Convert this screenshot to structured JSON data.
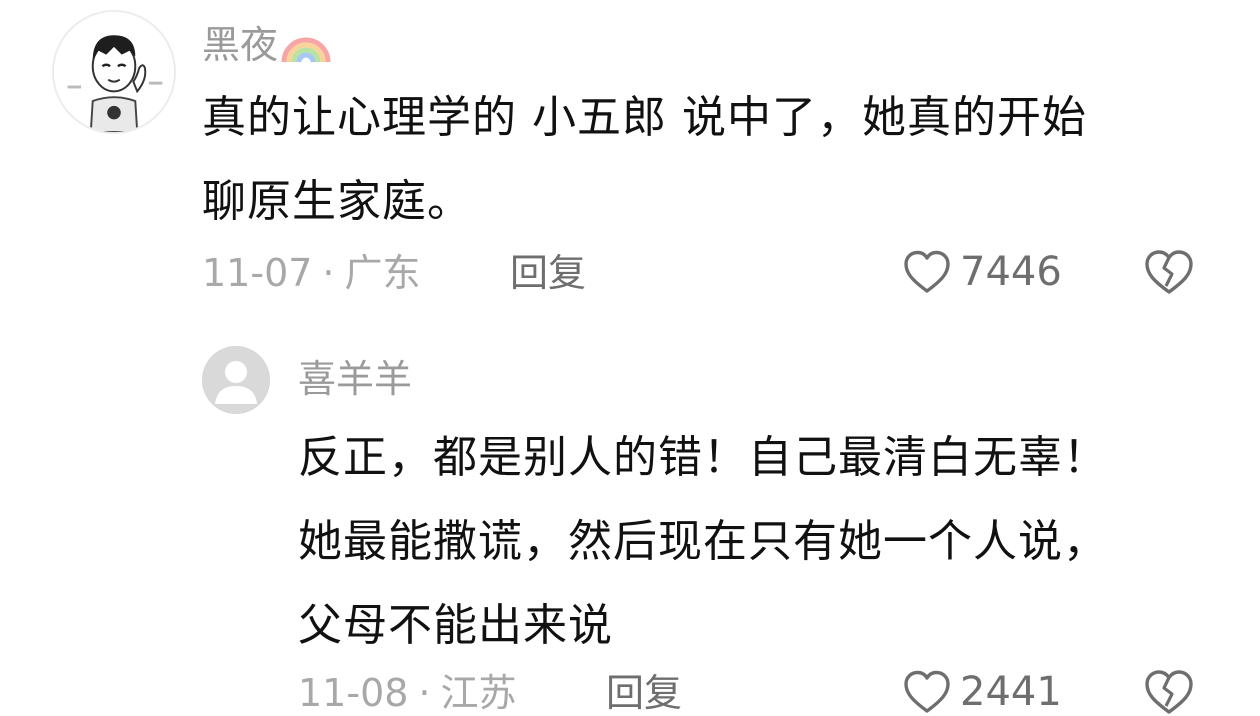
{
  "comment": {
    "username": "黑夜",
    "username_icon": "rainbow-icon",
    "text_lines": [
      "真的让心理学的 小五郎 说中了，她真的开始",
      "聊原生家庭。"
    ],
    "date": "11-07",
    "separator": "·",
    "location": "广东",
    "reply_label": "回复",
    "likes": "7446",
    "like_icon": "heart-outline-icon",
    "dislike_icon": "broken-heart-icon"
  },
  "reply": {
    "username": "喜羊羊",
    "avatar_icon": "default-avatar-icon",
    "text_lines": [
      "反正，都是别人的错！自己最清白无辜！",
      "她最能撒谎，然后现在只有她一个人说，",
      "父母不能出来说"
    ],
    "date": "11-08",
    "separator": "·",
    "location": "江苏",
    "reply_label": "回复",
    "likes": "2441",
    "like_icon": "heart-outline-icon",
    "dislike_icon": "broken-heart-icon"
  },
  "colors": {
    "text": "#111111",
    "username": "#9a9a9a",
    "meta": "#a8a8a8",
    "action": "#6e6e6e",
    "avatar_placeholder": "#d9d9d9"
  }
}
